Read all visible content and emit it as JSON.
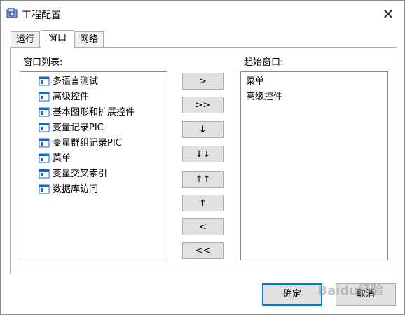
{
  "window": {
    "title": "工程配置"
  },
  "tabs": [
    {
      "label": "运行"
    },
    {
      "label": "窗口"
    },
    {
      "label": "网络"
    }
  ],
  "window_list": {
    "label": "窗口列表:",
    "items": [
      "多语言测试",
      "高级控件",
      "基本图形和扩展控件",
      "变量记录PIC",
      "变量群组记录PIC",
      "菜单",
      "变量交叉索引",
      "数据库访问"
    ]
  },
  "start_window": {
    "label": "起始窗口:",
    "items": [
      "菜单",
      "高级控件"
    ]
  },
  "transfer_buttons": {
    "add": ">",
    "add_all": ">>",
    "move_down": "↓",
    "move_bottom": "↓↓",
    "move_top": "↑↑",
    "move_up": "↑",
    "remove": "<",
    "remove_all": "<<"
  },
  "footer": {
    "ok": "确定",
    "cancel": "取消"
  },
  "watermark": "Baidu经验",
  "colors": {
    "item_icon": "#1e63c4",
    "default_button_border": "#0078d7"
  }
}
